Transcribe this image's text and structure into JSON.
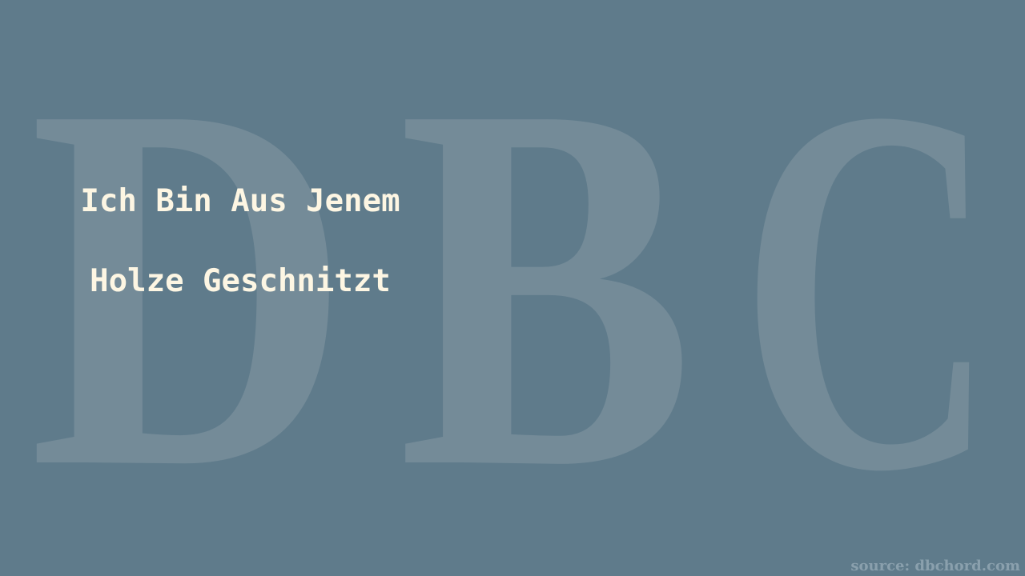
{
  "watermark": {
    "text": "DBC",
    "color": "#748b98"
  },
  "background_color": "#5f7b8b",
  "lyrics": {
    "line1": "Ich Bin Aus Jenem",
    "line2": "Holze Geschnitzt",
    "color": "#fdf6e3"
  },
  "source": "source: dbchord.com"
}
